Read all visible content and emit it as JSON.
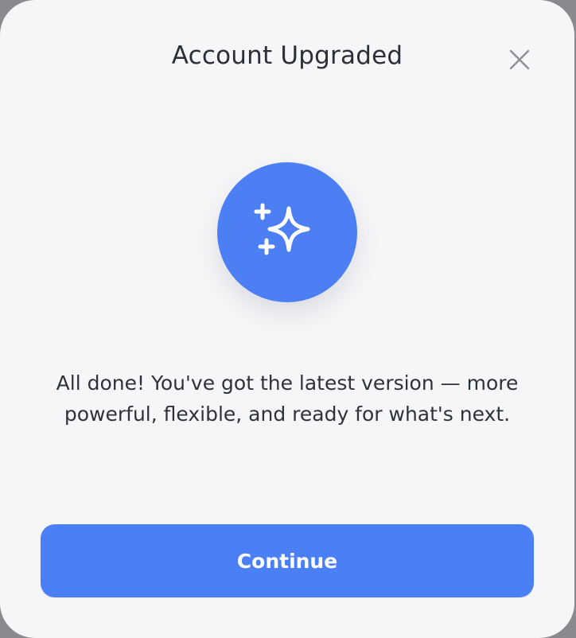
{
  "modal": {
    "title": "Account Upgraded",
    "close_icon": "close-icon",
    "hero_icon": "sparkles-icon",
    "message": "All done! You've got the latest version — more powerful, flexible, and ready for what's next.",
    "continue_label": "Continue"
  },
  "colors": {
    "accent": "#4b7ff3",
    "button": "#4b7ff6",
    "modal_background": "#f6f6f8",
    "title_text": "#2b2f38",
    "close_icon": "#8e9096"
  }
}
